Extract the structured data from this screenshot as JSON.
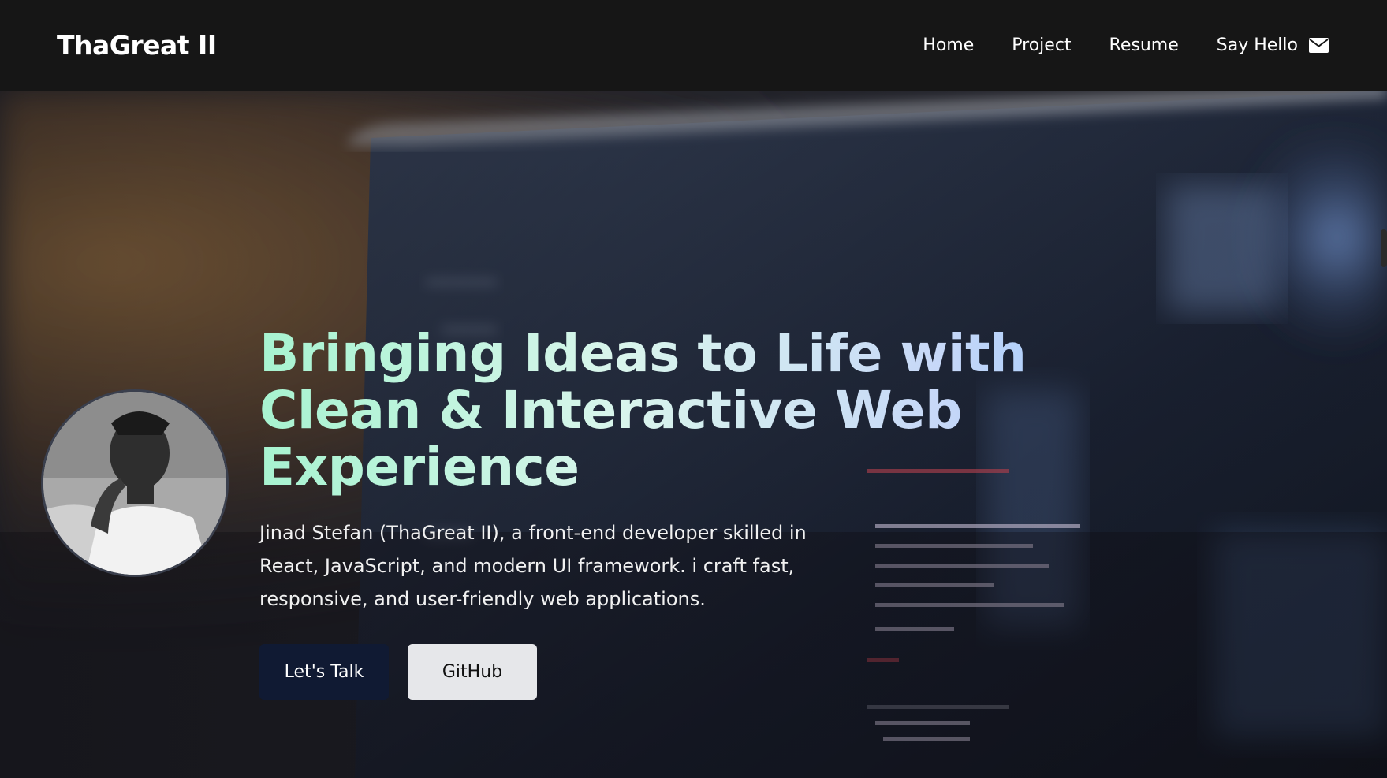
{
  "nav": {
    "brand": "ThaGreat II",
    "links": [
      {
        "label": "Home"
      },
      {
        "label": "Project"
      },
      {
        "label": "Resume"
      },
      {
        "label": "Say Hello",
        "icon": "mail-icon"
      }
    ]
  },
  "hero": {
    "title": "Bringing Ideas to Life with Clean & Interactive Web Experience",
    "subtitle": "Jinad Stefan (ThaGreat II), a front-end developer skilled in React, JavaScript, and modern UI framework. i craft fast, responsive, and user-friendly web applications.",
    "primary_button": "Let's Talk",
    "secondary_button": "GitHub",
    "background": "blurred laptop screen with code",
    "avatar": "black-and-white profile photo"
  },
  "colors": {
    "nav_bg": "#161616",
    "primary_button": "#101a33",
    "secondary_button": "#e6e7ea",
    "title_gradient": [
      "#a7f3d0",
      "#93c5fd"
    ]
  }
}
